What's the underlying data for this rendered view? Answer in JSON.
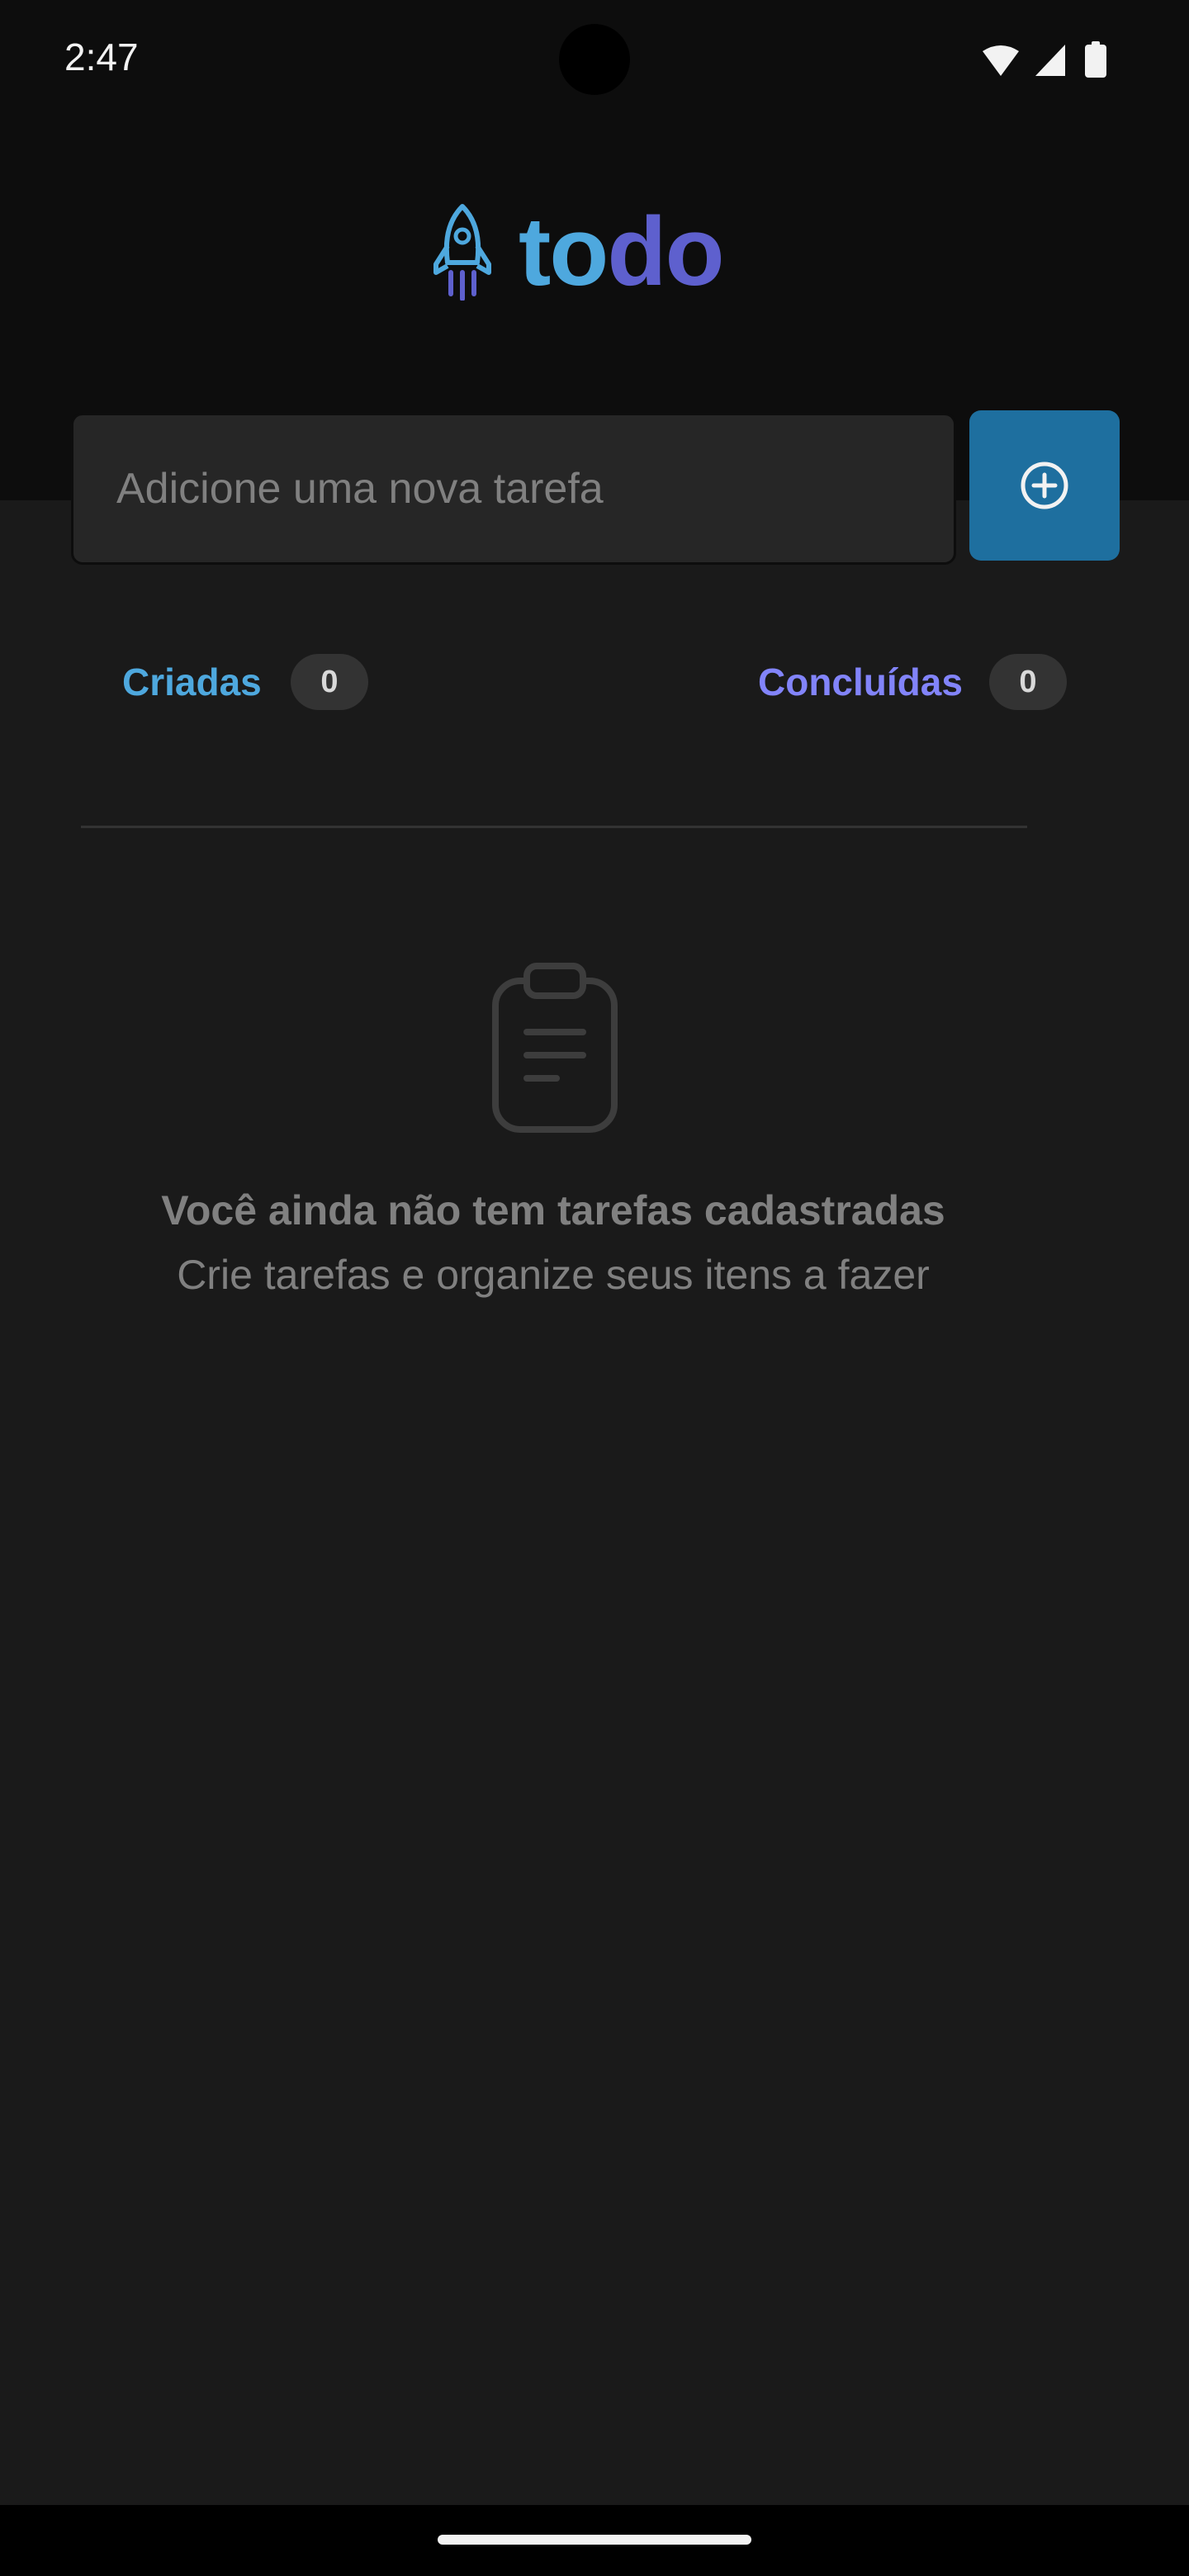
{
  "status_bar": {
    "time": "2:47",
    "icons": [
      "wifi-icon",
      "cellular-signal-icon",
      "battery-icon"
    ]
  },
  "header": {
    "logo_icon": "rocket-icon",
    "logo_text_part1": "to",
    "logo_text_part2": "do"
  },
  "task_form": {
    "input_value": "",
    "input_placeholder": "Adicione uma nova tarefa",
    "add_button_icon": "plus-circle-icon"
  },
  "counters": {
    "created_label": "Criadas",
    "created_count": "0",
    "done_label": "Concluídas",
    "done_count": "0"
  },
  "empty_state": {
    "icon": "clipboard-icon",
    "title": "Você ainda não tem tarefas cadastradas",
    "subtitle": "Crie tarefas e organize seus itens a fazer"
  },
  "colors": {
    "background": "#1a1a1a",
    "header_background": "#0d0d0d",
    "input_background": "#262626",
    "button_blue": "#1e6f9f",
    "created_blue": "#4ea8de",
    "done_purple": "#8284fa",
    "logo_purple": "#5e60ce",
    "badge_gray": "#333333",
    "muted_text": "#808080"
  }
}
